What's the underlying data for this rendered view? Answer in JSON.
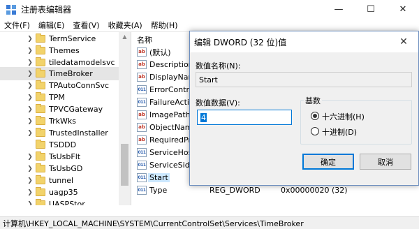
{
  "window": {
    "title": "注册表编辑器",
    "controls": {
      "minimize": "—",
      "maximize": "☐",
      "close": "✕"
    }
  },
  "menu": [
    "文件(F)",
    "编辑(E)",
    "查看(V)",
    "收藏夹(A)",
    "帮助(H)"
  ],
  "tree": {
    "items": [
      {
        "label": "TermService",
        "expandable": true
      },
      {
        "label": "Themes",
        "expandable": true
      },
      {
        "label": "tiledatamodelsvc",
        "expandable": true
      },
      {
        "label": "TimeBroker",
        "expandable": true,
        "selected": true
      },
      {
        "label": "TPAutoConnSvc",
        "expandable": true
      },
      {
        "label": "TPM",
        "expandable": true
      },
      {
        "label": "TPVCGateway",
        "expandable": true
      },
      {
        "label": "TrkWks",
        "expandable": true
      },
      {
        "label": "TrustedInstaller",
        "expandable": true
      },
      {
        "label": "TSDDD",
        "expandable": true
      },
      {
        "label": "TsUsbFlt",
        "expandable": true
      },
      {
        "label": "TsUsbGD",
        "expandable": true
      },
      {
        "label": "tunnel",
        "expandable": true
      },
      {
        "label": "uagp35",
        "expandable": true
      },
      {
        "label": "UASPStor",
        "expandable": true
      }
    ]
  },
  "list": {
    "header_name": "名称",
    "rows": [
      {
        "icon": "ab",
        "name": "(默认)"
      },
      {
        "icon": "ab",
        "name": "Description"
      },
      {
        "icon": "ab",
        "name": "DisplayName"
      },
      {
        "icon": "dw",
        "name": "ErrorControl"
      },
      {
        "icon": "dw",
        "name": "FailureActions"
      },
      {
        "icon": "ab",
        "name": "ImagePath"
      },
      {
        "icon": "ab",
        "name": "ObjectName"
      },
      {
        "icon": "ab",
        "name": "RequiredPrivileges"
      },
      {
        "icon": "ab",
        "name": "ServiceHostSharing"
      },
      {
        "icon": "dw",
        "name": "ServiceSidType"
      },
      {
        "icon": "dw",
        "name": "Start",
        "selected": true
      },
      {
        "icon": "dw",
        "name": "Type",
        "type": "REG_DWORD",
        "data": "0x00000020 (32)"
      }
    ]
  },
  "status": "计算机\\HKEY_LOCAL_MACHINE\\SYSTEM\\CurrentControlSet\\Services\\TimeBroker",
  "dialog": {
    "title": "编辑 DWORD (32 位)值",
    "close": "✕",
    "value_name_label": "数值名称(N):",
    "value_name": "Start",
    "value_data_label": "数值数据(V):",
    "value_data": "4",
    "base_label": "基数",
    "radix_options": [
      {
        "label": "十六进制(H)",
        "checked": true
      },
      {
        "label": "十进制(D)",
        "checked": false
      }
    ],
    "ok_label": "确定",
    "cancel_label": "取消"
  }
}
